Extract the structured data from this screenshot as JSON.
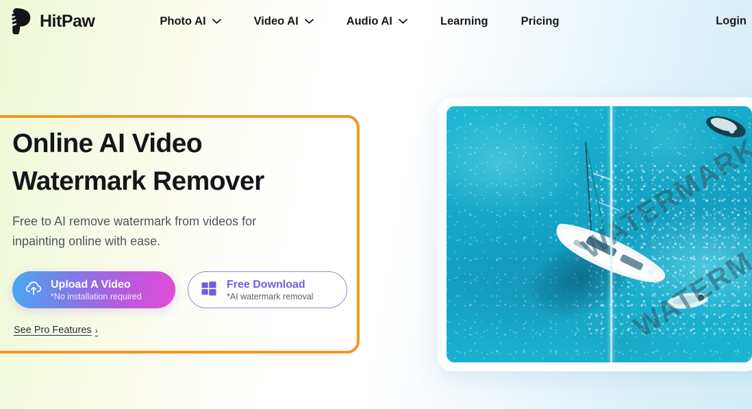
{
  "brand": {
    "name": "HitPaw",
    "logo_icon": "hitpaw-paw-logo",
    "accent_orange": "#f7941d",
    "accent_purple": "#6c5fe0"
  },
  "header": {
    "nav": [
      {
        "label": "Photo AI",
        "has_dropdown": true,
        "icon": "chevron-down-icon"
      },
      {
        "label": "Video AI",
        "has_dropdown": true,
        "icon": "chevron-down-icon"
      },
      {
        "label": "Audio AI",
        "has_dropdown": true,
        "icon": "chevron-down-icon"
      },
      {
        "label": "Learning",
        "has_dropdown": false,
        "icon": ""
      },
      {
        "label": "Pricing",
        "has_dropdown": false,
        "icon": ""
      }
    ],
    "login_label": "Login"
  },
  "hero": {
    "title": "Online AI Video\nWatermark Remover",
    "subtitle": "Free to AI remove watermark from videos for\ninpainting online with ease.",
    "upload_button": {
      "icon": "cloud-upload-icon",
      "label": "Upload A Video",
      "note": "*No installation required"
    },
    "download_button": {
      "icon": "windows-icon",
      "label": "Free Download",
      "note": "*AI watermark removal"
    },
    "pro_link": {
      "label": "See Pro Features",
      "arrow": "›"
    }
  },
  "media": {
    "type": "before-after-comparison",
    "alt": "Aerial photo of a white sailboat on turquoise sea",
    "watermark_lines": [
      "WATERMARK",
      "WATERMARK"
    ],
    "divider_label": "comparison-slider"
  }
}
